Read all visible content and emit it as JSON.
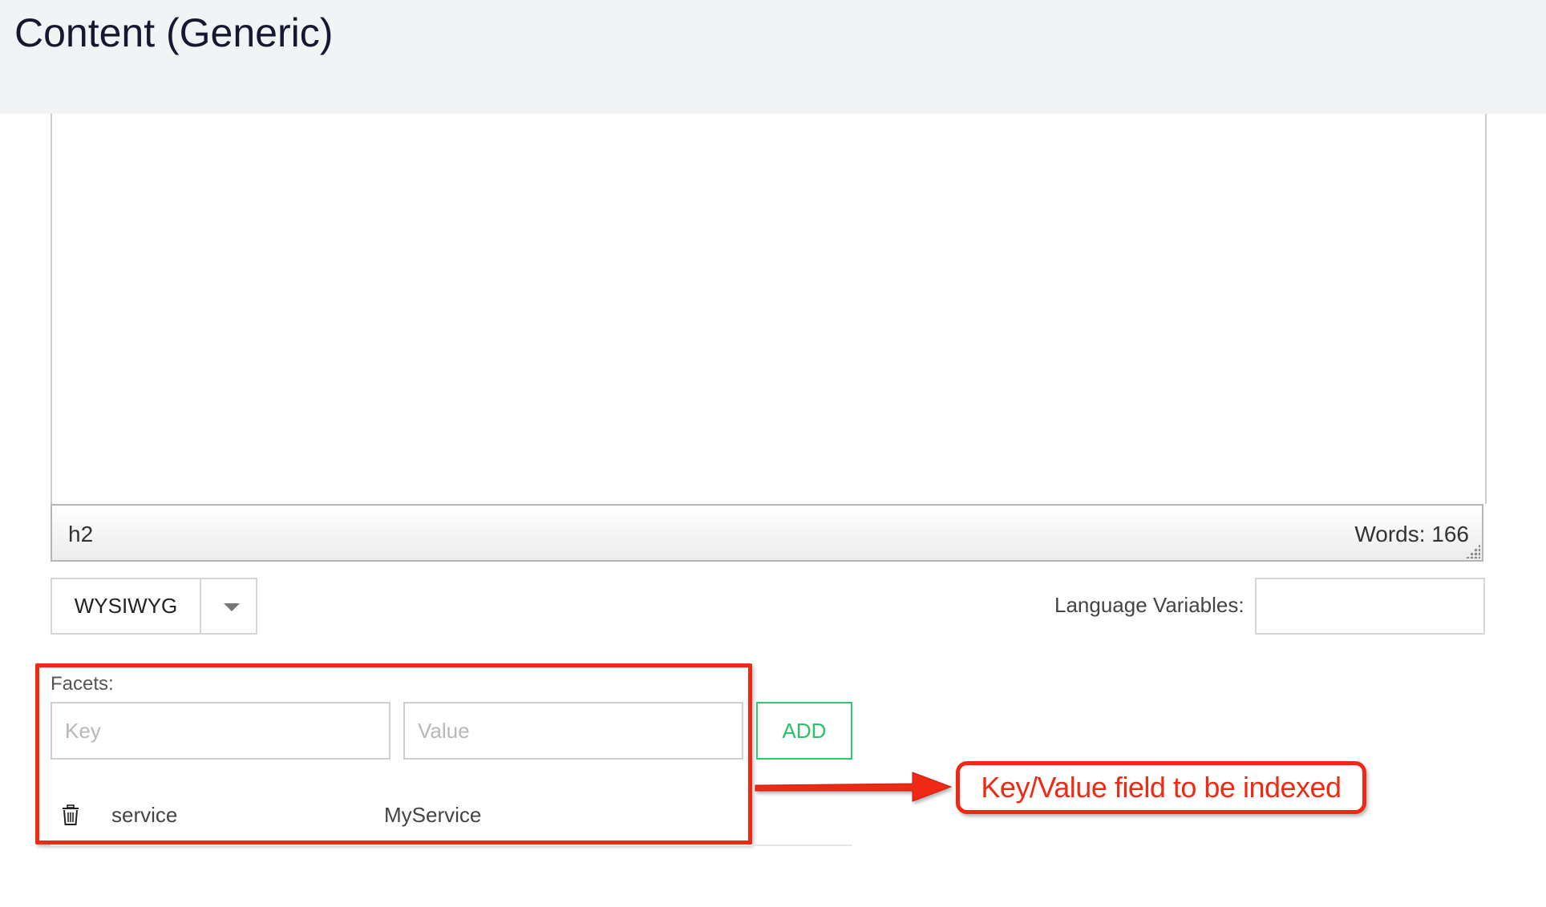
{
  "header": {
    "title": "Content (Generic)"
  },
  "editor": {
    "status_path": "h2",
    "word_count": "Words: 166"
  },
  "mode_select": {
    "selected": "WYSIWYG"
  },
  "language_variables": {
    "label": "Language Variables:",
    "value": ""
  },
  "facets": {
    "label": "Facets:",
    "key_placeholder": "Key",
    "value_placeholder": "Value",
    "add_label": "ADD",
    "items": [
      {
        "key": "service",
        "value": "MyService"
      }
    ]
  },
  "annotation": {
    "callout": "Key/Value field to be indexed",
    "color": "#ee2a14"
  },
  "colors": {
    "header_bg": "#f2f3f5",
    "title": "#16182f",
    "add_button": "#27c267"
  },
  "icons": {
    "delete": "trash-icon",
    "dropdown": "caret-down-icon",
    "resize": "resize-grip-icon"
  }
}
